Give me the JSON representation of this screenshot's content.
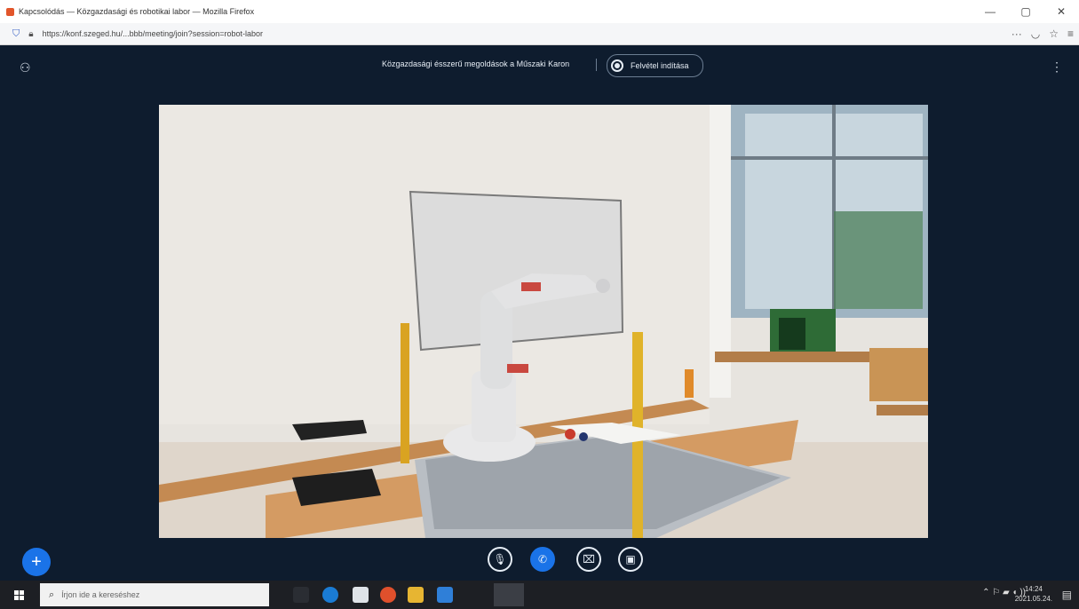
{
  "browser": {
    "title": "Kapcsolódás — Közgazdasági és robotikai labor — Mozilla Firefox",
    "url": "https://konf.szeged.hu/...bbb/meeting/join?session=robot-labor",
    "window_controls": [
      "—",
      "▢",
      "✕"
    ],
    "toolbar_icons": [
      "···",
      "pocket-icon",
      "star-icon",
      "menu-icon"
    ]
  },
  "meeting": {
    "title": "Közgazdasági ésszerű megoldások a Műszaki Karon",
    "record_label": "Felvétel indítása"
  },
  "controls": {
    "plus": "+"
  },
  "taskbar": {
    "search_placeholder": "Írjon ide a kereséshez",
    "time": "14:24",
    "date": "2021.05.24."
  },
  "colors": {
    "meeting_bg": "#0e1c2e",
    "accent": "#1a73e8",
    "taskbar": "#1d1f24"
  }
}
